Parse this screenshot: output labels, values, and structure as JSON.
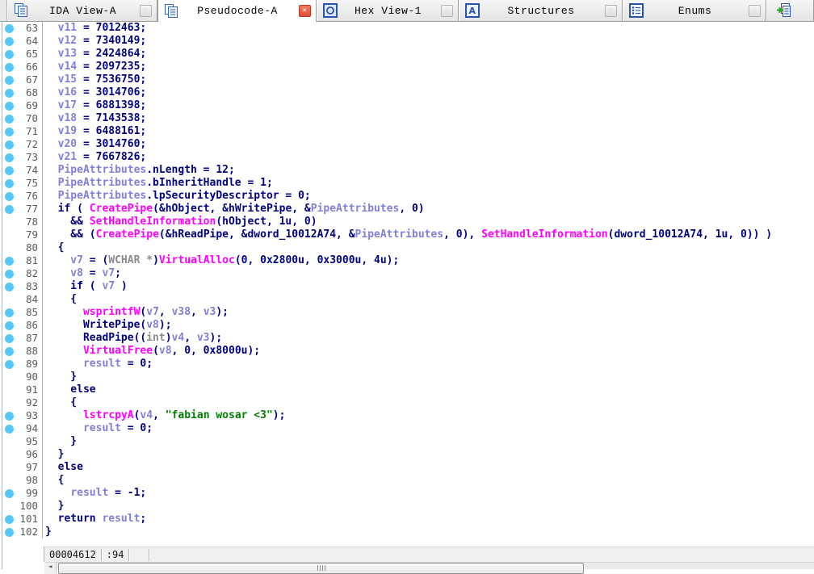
{
  "tab_bar": {
    "close_glyph": "✕",
    "tabs": [
      {
        "label": "IDA View-A",
        "icon": "pseudocode-icon",
        "active": false,
        "closable": true,
        "stub": false
      },
      {
        "label": "Pseudocode-A",
        "icon": "pseudocode-icon",
        "active": true,
        "closable": true,
        "stub": false
      },
      {
        "label": "Hex View-1",
        "icon": "hex-icon",
        "active": false,
        "closable": true,
        "stub": false
      },
      {
        "label": "Structures",
        "icon": "structures-icon",
        "active": false,
        "closable": true,
        "stub": false
      },
      {
        "label": "Enums",
        "icon": "enums-icon",
        "active": false,
        "closable": true,
        "stub": false
      },
      {
        "label": "",
        "icon": "imports-icon",
        "active": false,
        "closable": false,
        "stub": true
      }
    ],
    "tab_widths": [
      186,
      197,
      176,
      203,
      178
    ]
  },
  "colors": {
    "keyword_number": "#000080",
    "local_variable": "#8080d8",
    "imported_function": "#ff00ff",
    "type": "#8a8a8a",
    "string_literal": "#008000",
    "breakpoint_dot": "#58c6f2",
    "active_close": "#e05038"
  },
  "pseudocode": {
    "first_line": 63,
    "last_line": 102,
    "lines": [
      {
        "n": 63,
        "bp": true,
        "spans": [
          [
            "v",
            "  v11"
          ],
          [
            "k",
            " = 7012463;"
          ]
        ]
      },
      {
        "n": 64,
        "bp": true,
        "spans": [
          [
            "v",
            "  v12"
          ],
          [
            "k",
            " = 7340149;"
          ]
        ]
      },
      {
        "n": 65,
        "bp": true,
        "spans": [
          [
            "v",
            "  v13"
          ],
          [
            "k",
            " = 2424864;"
          ]
        ]
      },
      {
        "n": 66,
        "bp": true,
        "spans": [
          [
            "v",
            "  v14"
          ],
          [
            "k",
            " = 2097235;"
          ]
        ]
      },
      {
        "n": 67,
        "bp": true,
        "spans": [
          [
            "v",
            "  v15"
          ],
          [
            "k",
            " = 7536750;"
          ]
        ]
      },
      {
        "n": 68,
        "bp": true,
        "spans": [
          [
            "v",
            "  v16"
          ],
          [
            "k",
            " = 3014706;"
          ]
        ]
      },
      {
        "n": 69,
        "bp": true,
        "spans": [
          [
            "v",
            "  v17"
          ],
          [
            "k",
            " = 6881398;"
          ]
        ]
      },
      {
        "n": 70,
        "bp": true,
        "spans": [
          [
            "v",
            "  v18"
          ],
          [
            "k",
            " = 7143538;"
          ]
        ]
      },
      {
        "n": 71,
        "bp": true,
        "spans": [
          [
            "v",
            "  v19"
          ],
          [
            "k",
            " = 6488161;"
          ]
        ]
      },
      {
        "n": 72,
        "bp": true,
        "spans": [
          [
            "v",
            "  v20"
          ],
          [
            "k",
            " = 3014760;"
          ]
        ]
      },
      {
        "n": 73,
        "bp": true,
        "spans": [
          [
            "v",
            "  v21"
          ],
          [
            "k",
            " = 7667826;"
          ]
        ]
      },
      {
        "n": 74,
        "bp": true,
        "spans": [
          [
            "v",
            "  PipeAttributes"
          ],
          [
            "k",
            ".nLength = 12;"
          ]
        ]
      },
      {
        "n": 75,
        "bp": true,
        "spans": [
          [
            "v",
            "  PipeAttributes"
          ],
          [
            "k",
            ".bInheritHandle = 1;"
          ]
        ]
      },
      {
        "n": 76,
        "bp": true,
        "spans": [
          [
            "v",
            "  PipeAttributes"
          ],
          [
            "k",
            ".lpSecurityDescriptor = 0;"
          ]
        ]
      },
      {
        "n": 77,
        "bp": true,
        "spans": [
          [
            "k",
            "  if ( "
          ],
          [
            "m",
            "CreatePipe"
          ],
          [
            "k",
            "(&hObject, &hWritePipe, &"
          ],
          [
            "v",
            "PipeAttributes"
          ],
          [
            "k",
            ", 0)"
          ]
        ]
      },
      {
        "n": 78,
        "bp": false,
        "spans": [
          [
            "k",
            "    && "
          ],
          [
            "m",
            "SetHandleInformation"
          ],
          [
            "k",
            "(hObject, 1u, 0)"
          ]
        ]
      },
      {
        "n": 79,
        "bp": false,
        "spans": [
          [
            "k",
            "    && ("
          ],
          [
            "m",
            "CreatePipe"
          ],
          [
            "k",
            "(&hReadPipe, &dword_10012A74, &"
          ],
          [
            "v",
            "PipeAttributes"
          ],
          [
            "k",
            ", 0), "
          ],
          [
            "m",
            "SetHandleInformation"
          ],
          [
            "k",
            "(dword_10012A74, 1u, 0)) )"
          ]
        ]
      },
      {
        "n": 80,
        "bp": false,
        "spans": [
          [
            "k",
            "  {"
          ]
        ]
      },
      {
        "n": 81,
        "bp": true,
        "spans": [
          [
            "v",
            "    v7"
          ],
          [
            "k",
            " = ("
          ],
          [
            "t",
            "WCHAR *"
          ],
          [
            "k",
            ")"
          ],
          [
            "m",
            "VirtualAlloc"
          ],
          [
            "k",
            "(0, 0x2800u, 0x3000u, 4u);"
          ]
        ]
      },
      {
        "n": 82,
        "bp": true,
        "spans": [
          [
            "v",
            "    v8"
          ],
          [
            "k",
            " = "
          ],
          [
            "v",
            "v7"
          ],
          [
            "k",
            ";"
          ]
        ]
      },
      {
        "n": 83,
        "bp": true,
        "spans": [
          [
            "k",
            "    if ( "
          ],
          [
            "v",
            "v7"
          ],
          [
            "k",
            " )"
          ]
        ]
      },
      {
        "n": 84,
        "bp": false,
        "spans": [
          [
            "k",
            "    {"
          ]
        ]
      },
      {
        "n": 85,
        "bp": true,
        "spans": [
          [
            "k",
            "      "
          ],
          [
            "m",
            "wsprintfW"
          ],
          [
            "k",
            "("
          ],
          [
            "v",
            "v7"
          ],
          [
            "k",
            ", "
          ],
          [
            "v",
            "v38"
          ],
          [
            "k",
            ", "
          ],
          [
            "v",
            "v3"
          ],
          [
            "k",
            ");"
          ]
        ]
      },
      {
        "n": 86,
        "bp": true,
        "spans": [
          [
            "k",
            "      WritePipe("
          ],
          [
            "v",
            "v8"
          ],
          [
            "k",
            ");"
          ]
        ]
      },
      {
        "n": 87,
        "bp": true,
        "spans": [
          [
            "k",
            "      ReadPipe(("
          ],
          [
            "t",
            "int"
          ],
          [
            "k",
            ")"
          ],
          [
            "v",
            "v4"
          ],
          [
            "k",
            ", "
          ],
          [
            "v",
            "v3"
          ],
          [
            "k",
            ");"
          ]
        ]
      },
      {
        "n": 88,
        "bp": true,
        "spans": [
          [
            "k",
            "      "
          ],
          [
            "m",
            "VirtualFree"
          ],
          [
            "k",
            "("
          ],
          [
            "v",
            "v8"
          ],
          [
            "k",
            ", 0, 0x8000u);"
          ]
        ]
      },
      {
        "n": 89,
        "bp": true,
        "spans": [
          [
            "k",
            "      "
          ],
          [
            "v",
            "result"
          ],
          [
            "k",
            " = 0;"
          ]
        ]
      },
      {
        "n": 90,
        "bp": false,
        "spans": [
          [
            "k",
            "    }"
          ]
        ]
      },
      {
        "n": 91,
        "bp": false,
        "spans": [
          [
            "k",
            "    else"
          ]
        ]
      },
      {
        "n": 92,
        "bp": false,
        "spans": [
          [
            "k",
            "    {"
          ]
        ]
      },
      {
        "n": 93,
        "bp": true,
        "spans": [
          [
            "k",
            "      "
          ],
          [
            "m",
            "lstrcpyA"
          ],
          [
            "k",
            "("
          ],
          [
            "v",
            "v4"
          ],
          [
            "k",
            ", "
          ],
          [
            "s",
            "\"fabian wosar <3\""
          ],
          [
            "k",
            ");"
          ]
        ]
      },
      {
        "n": 94,
        "bp": true,
        "spans": [
          [
            "k",
            "      "
          ],
          [
            "v",
            "result"
          ],
          [
            "k",
            " = 0;"
          ]
        ]
      },
      {
        "n": 95,
        "bp": false,
        "spans": [
          [
            "k",
            "    }"
          ]
        ]
      },
      {
        "n": 96,
        "bp": false,
        "spans": [
          [
            "k",
            "  }"
          ]
        ]
      },
      {
        "n": 97,
        "bp": false,
        "spans": [
          [
            "k",
            "  else"
          ]
        ]
      },
      {
        "n": 98,
        "bp": false,
        "spans": [
          [
            "k",
            "  {"
          ]
        ]
      },
      {
        "n": 99,
        "bp": true,
        "spans": [
          [
            "k",
            "    "
          ],
          [
            "v",
            "result"
          ],
          [
            "k",
            " = -1;"
          ]
        ]
      },
      {
        "n": 100,
        "bp": false,
        "spans": [
          [
            "k",
            "  }"
          ]
        ]
      },
      {
        "n": 101,
        "bp": true,
        "spans": [
          [
            "k",
            "  return "
          ],
          [
            "v",
            "result"
          ],
          [
            "k",
            ";"
          ]
        ]
      },
      {
        "n": 102,
        "bp": true,
        "spans": [
          [
            "k",
            "}"
          ]
        ]
      }
    ]
  },
  "status_bar": {
    "cells": [
      "00004612",
      ":94"
    ]
  },
  "h_scrollbar": {
    "left_arrow": "◄"
  }
}
